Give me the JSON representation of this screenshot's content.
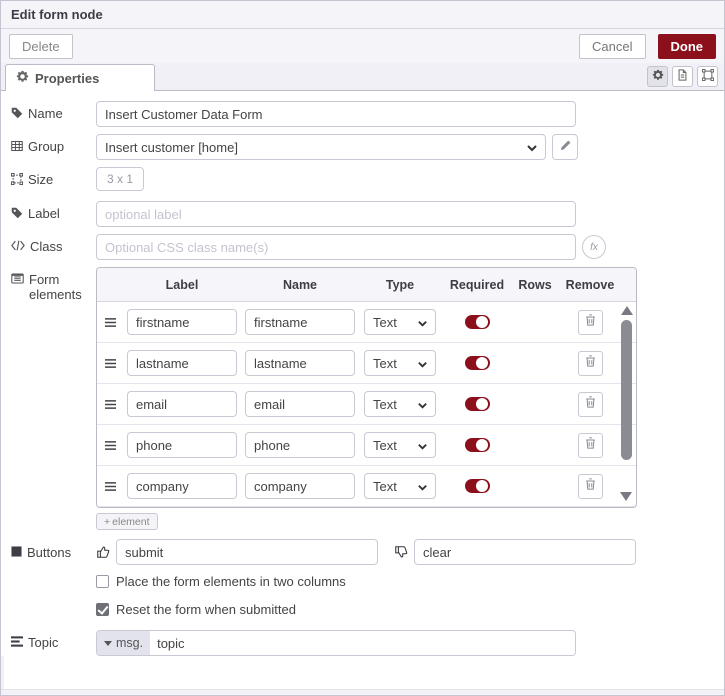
{
  "dialog": {
    "title": "Edit form node"
  },
  "toolbar": {
    "delete_label": "Delete",
    "cancel_label": "Cancel",
    "done_label": "Done"
  },
  "tabs": {
    "properties_label": "Properties"
  },
  "fields": {
    "name": {
      "label": "Name",
      "value": "Insert Customer Data Form"
    },
    "group": {
      "label": "Group",
      "value": "Insert customer [home]"
    },
    "size": {
      "label": "Size",
      "value": "3 x 1"
    },
    "label": {
      "label": "Label",
      "placeholder": "optional label"
    },
    "class": {
      "label": "Class",
      "placeholder": "Optional CSS class name(s)"
    },
    "form_elements": {
      "label": "Form elements"
    },
    "buttons": {
      "label": "Buttons",
      "submit_value": "submit",
      "clear_value": "clear"
    },
    "topic": {
      "label": "Topic",
      "prefix": "msg.",
      "value": "topic"
    }
  },
  "form_table": {
    "headers": [
      "Label",
      "Name",
      "Type",
      "Required",
      "Rows",
      "Remove"
    ],
    "rows": [
      {
        "label": "firstname",
        "name": "firstname",
        "type": "Text",
        "required": true
      },
      {
        "label": "lastname",
        "name": "lastname",
        "type": "Text",
        "required": true
      },
      {
        "label": "email",
        "name": "email",
        "type": "Text",
        "required": true
      },
      {
        "label": "phone",
        "name": "phone",
        "type": "Text",
        "required": true
      },
      {
        "label": "company",
        "name": "company",
        "type": "Text",
        "required": true
      }
    ],
    "add_label": "element"
  },
  "checkboxes": [
    {
      "label": "Place the form elements in two columns",
      "checked": false
    },
    {
      "label": "Reset the form when submitted",
      "checked": true
    }
  ],
  "icons": {
    "plus": "+",
    "class_fx": "fx"
  },
  "colors": {
    "accent_red": "#8C101C",
    "toggle_on": "#8C101C",
    "header_bg": "#f4f4f9",
    "table_header_bg": "#f6f6fa"
  }
}
